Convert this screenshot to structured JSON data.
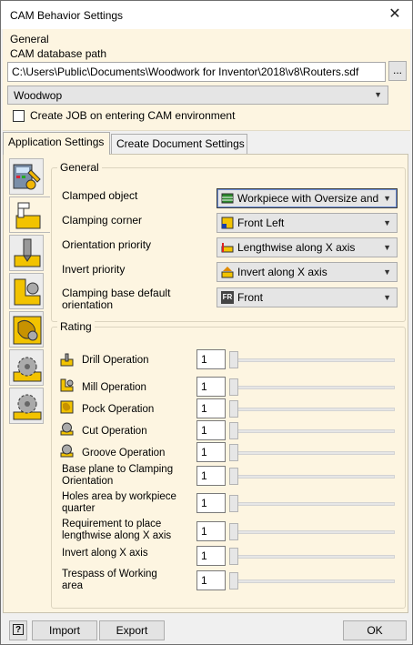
{
  "window": {
    "title": "CAM Behavior Settings"
  },
  "top": {
    "section": "General",
    "db_label": "CAM database path",
    "db_path": "C:\\Users\\Public\\Documents\\Woodwork for Inventor\\2018\\v8\\Routers.sdf",
    "browse_label": "...",
    "machine": "Woodwop",
    "create_job_label": "Create JOB on entering CAM environment",
    "create_job_checked": false
  },
  "tabs": [
    {
      "label": "Application Settings",
      "active": true
    },
    {
      "label": "Create Document Settings",
      "active": false
    }
  ],
  "general": {
    "title": "General",
    "rows": [
      {
        "label": "Clamped object",
        "value": "Workpiece with Oversize and",
        "icon": "workpiece-icon"
      },
      {
        "label": "Clamping corner",
        "value": "Front Left",
        "icon": "corner-icon"
      },
      {
        "label": "Orientation priority",
        "value": "Lengthwise along X axis",
        "icon": "lengthwise-icon"
      },
      {
        "label": "Invert priority",
        "value": "Invert along X axis",
        "icon": "invert-icon"
      },
      {
        "label": "Clamping base default orientation",
        "value": "Front",
        "icon": "front-icon",
        "icon_text": "FR"
      }
    ]
  },
  "rating": {
    "title": "Rating",
    "rows": [
      {
        "label": "Drill Operation",
        "value": "1",
        "icon": "drill-icon"
      },
      {
        "label": "Mill Operation",
        "value": "1",
        "icon": "mill-icon"
      },
      {
        "label": "Pock Operation",
        "value": "1",
        "icon": "pocket-icon"
      },
      {
        "label": "Cut Operation",
        "value": "1",
        "icon": "cut-icon"
      },
      {
        "label": "Groove Operation",
        "value": "1",
        "icon": "groove-icon"
      },
      {
        "label": "Base plane to Clamping Orientation",
        "value": "1"
      },
      {
        "label": "Holes area by workpiece quarter",
        "value": "1"
      },
      {
        "label": "Requirement to place lengthwise along X axis",
        "value": "1"
      },
      {
        "label": "Invert along X axis",
        "value": "1"
      },
      {
        "label": "Trespass of Working area",
        "value": "1"
      }
    ]
  },
  "footer": {
    "help": "?",
    "import": "Import",
    "export": "Export",
    "ok": "OK"
  },
  "side_icons": [
    "machine-settings-icon",
    "clamping-icon",
    "drill-category-icon",
    "mill-category-icon",
    "pocket-category-icon",
    "cut-category-icon",
    "groove-category-icon"
  ]
}
